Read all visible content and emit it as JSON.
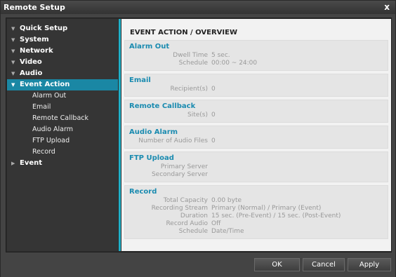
{
  "window": {
    "title": "Remote Setup",
    "close_label": "x"
  },
  "sidebar": {
    "items": [
      {
        "label": "Quick Setup"
      },
      {
        "label": "System"
      },
      {
        "label": "Network"
      },
      {
        "label": "Video"
      },
      {
        "label": "Audio"
      },
      {
        "label": "Event Action"
      },
      {
        "label": "Alarm Out"
      },
      {
        "label": "Email"
      },
      {
        "label": "Remote Callback"
      },
      {
        "label": "Audio Alarm"
      },
      {
        "label": "FTP Upload"
      },
      {
        "label": "Record"
      },
      {
        "label": "Event"
      }
    ]
  },
  "main": {
    "title": "EVENT ACTION / OVERVIEW",
    "sections": [
      {
        "title": "Alarm Out",
        "rows": [
          {
            "k": "Dwell Time",
            "v": "5 sec."
          },
          {
            "k": "Schedule",
            "v": "00:00 ~ 24:00"
          }
        ]
      },
      {
        "title": "Email",
        "rows": [
          {
            "k": "Recipient(s)",
            "v": "0"
          }
        ]
      },
      {
        "title": "Remote Callback",
        "rows": [
          {
            "k": "Site(s)",
            "v": "0"
          }
        ]
      },
      {
        "title": "Audio Alarm",
        "rows": [
          {
            "k": "Number of Audio Files",
            "v": "0"
          }
        ]
      },
      {
        "title": "FTP Upload",
        "rows": [
          {
            "k": "Primary Server",
            "v": ""
          },
          {
            "k": "Secondary Server",
            "v": ""
          }
        ]
      },
      {
        "title": "Record",
        "rows": [
          {
            "k": "Total Capacity",
            "v": "0.00 byte"
          },
          {
            "k": "Recording Stream",
            "v": "Primary (Normal) / Primary (Event)"
          },
          {
            "k": "Duration",
            "v": "15 sec. (Pre-Event) / 15 sec. (Post-Event)"
          },
          {
            "k": "Record Audio",
            "v": "Off"
          },
          {
            "k": "Schedule",
            "v": "Date/Time"
          }
        ]
      }
    ]
  },
  "buttons": {
    "ok": "OK",
    "cancel": "Cancel",
    "apply": "Apply"
  },
  "colors": {
    "accent": "#1fb0c8",
    "active_item": "#1a87a4",
    "section_title": "#1a8bb0"
  }
}
